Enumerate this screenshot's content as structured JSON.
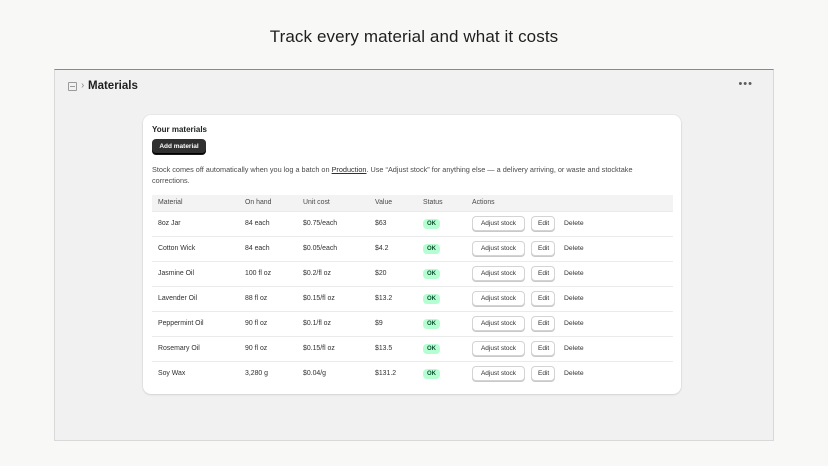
{
  "headline": "Track every material and what it costs",
  "window": {
    "breadcrumb_icon": "materials-icon",
    "title": "Materials",
    "more_icon": "more-horizontal-icon"
  },
  "card": {
    "title": "Your materials",
    "add_button": "Add material",
    "info_before": "Stock comes off automatically when you log a batch on ",
    "info_link": "Production",
    "info_after": ". Use “Adjust stock” for anything else — a delivery arriving, or waste and stocktake corrections."
  },
  "table": {
    "headers": [
      "Material",
      "On hand",
      "Unit cost",
      "Value",
      "Status",
      "Actions"
    ],
    "adjust_label": "Adjust stock",
    "edit_label": "Edit",
    "delete_label": "Delete",
    "rows": [
      {
        "material": "8oz Jar",
        "on_hand": "84 each",
        "unit_cost": "$0.75/each",
        "value": "$63",
        "status": "OK"
      },
      {
        "material": "Cotton Wick",
        "on_hand": "84 each",
        "unit_cost": "$0.05/each",
        "value": "$4.2",
        "status": "OK"
      },
      {
        "material": "Jasmine Oil",
        "on_hand": "100 fl oz",
        "unit_cost": "$0.2/fl oz",
        "value": "$20",
        "status": "OK"
      },
      {
        "material": "Lavender Oil",
        "on_hand": "88 fl oz",
        "unit_cost": "$0.15/fl oz",
        "value": "$13.2",
        "status": "OK"
      },
      {
        "material": "Peppermint Oil",
        "on_hand": "90 fl oz",
        "unit_cost": "$0.1/fl oz",
        "value": "$9",
        "status": "OK"
      },
      {
        "material": "Rosemary Oil",
        "on_hand": "90 fl oz",
        "unit_cost": "$0.15/fl oz",
        "value": "$13.5",
        "status": "OK"
      },
      {
        "material": "Soy Wax",
        "on_hand": "3,280 g",
        "unit_cost": "$0.04/g",
        "value": "$131.2",
        "status": "OK"
      }
    ]
  },
  "colors": {
    "primary_button": "#303030",
    "ok_badge_bg": "#b4fed2",
    "ok_badge_text": "#0c5132",
    "page_bg": "#f8f8f7",
    "frame_bg": "#f1f1f1"
  }
}
